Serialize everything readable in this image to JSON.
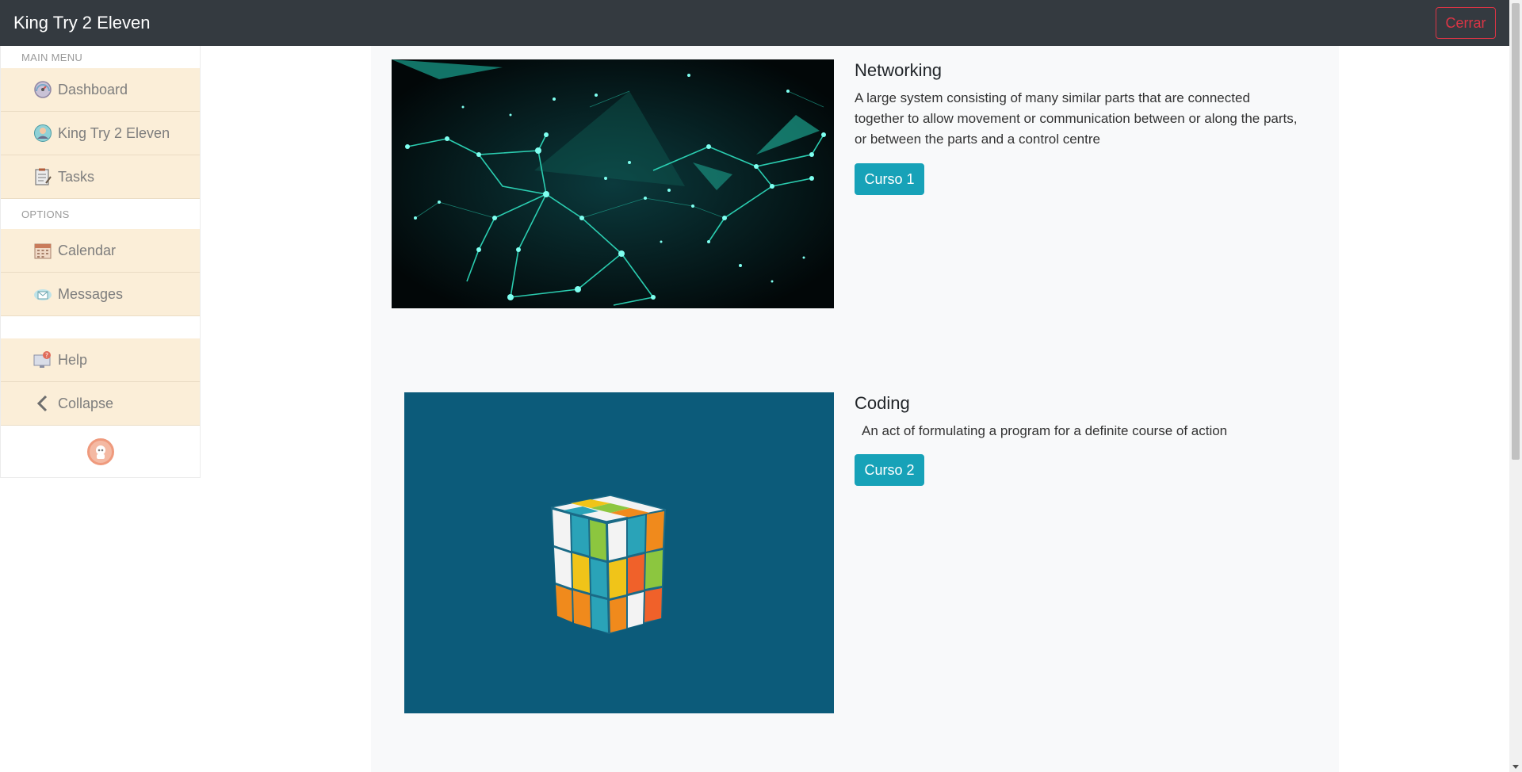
{
  "navbar": {
    "brand": "King Try 2 Eleven",
    "logout_label": "Cerrar"
  },
  "sidebar": {
    "main_menu_label": "MAIN MENU",
    "options_label": "OPTIONS",
    "main_items": [
      {
        "label": "Dashboard",
        "icon": "dashboard-icon"
      },
      {
        "label": "King Try 2 Eleven",
        "icon": "user-profile-icon"
      },
      {
        "label": "Tasks",
        "icon": "tasks-icon"
      }
    ],
    "option_items": [
      {
        "label": "Calendar",
        "icon": "calendar-icon"
      },
      {
        "label": "Messages",
        "icon": "messages-icon"
      }
    ],
    "bottom_items": [
      {
        "label": "Help",
        "icon": "help-icon"
      },
      {
        "label": "Collapse",
        "icon": "chevron-left-icon"
      }
    ]
  },
  "courses": [
    {
      "title": "Networking",
      "description": "A large system consisting of many similar parts that are connected together to allow movement or communication between or along the parts, or between the parts and a control centre",
      "button_label": "Curso 1",
      "image": "network-nodes-image"
    },
    {
      "title": "Coding",
      "description": "An act of formulating a program for a definite course of action",
      "button_label": "Curso 2",
      "image": "rubiks-cube-image"
    }
  ],
  "colors": {
    "navbar_bg": "#343a40",
    "sidebar_item_bg": "#fbeed8",
    "accent_info": "#17a2b8",
    "danger": "#dc3545",
    "content_bg": "#f8f9fa"
  }
}
